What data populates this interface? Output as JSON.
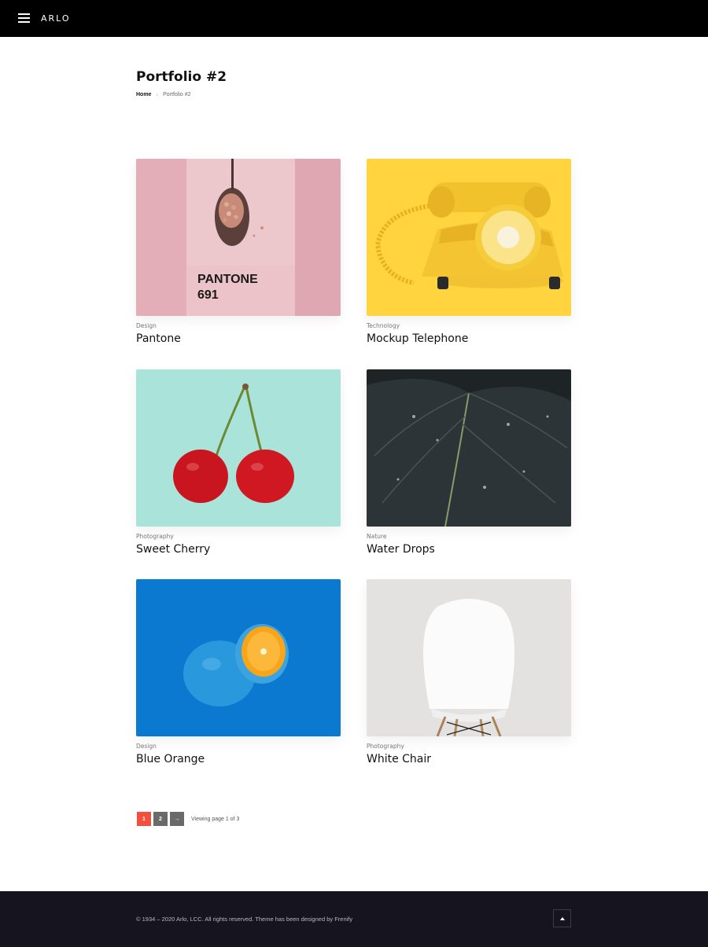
{
  "header": {
    "brand": "ARLO",
    "menu_icon": "hamburger-menu-icon"
  },
  "page": {
    "title": "Portfolio #2",
    "breadcrumb": {
      "home": "Home",
      "current": "Portfolio #2"
    }
  },
  "portfolio": {
    "items": [
      {
        "category": "Design",
        "title": "Pantone",
        "image_text": {
          "brand": "PANTONE",
          "code": "691"
        }
      },
      {
        "category": "Technology",
        "title": "Mockup Telephone"
      },
      {
        "category": "Photography",
        "title": "Sweet Cherry"
      },
      {
        "category": "Nature",
        "title": "Water Drops"
      },
      {
        "category": "Design",
        "title": "Blue Orange"
      },
      {
        "category": "Photography",
        "title": "White Chair"
      }
    ]
  },
  "pagination": {
    "pages": [
      "1",
      "2"
    ],
    "next": "→",
    "status": "Viewing page 1 of 3",
    "current": 1
  },
  "footer": {
    "copyright": "© 1934 – 2020 Arlo, LCC. All rights reserved. Theme has been designed by Frenify",
    "to_top_icon": "arrow-up-icon"
  },
  "colors": {
    "header_bg": "#000000",
    "footer_bg": "#16141f",
    "pager_active": "#f24f3d",
    "pager_normal": "#6a6a6a"
  }
}
